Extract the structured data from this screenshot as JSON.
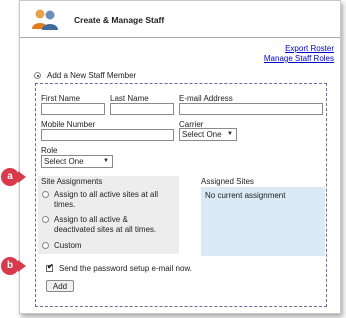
{
  "header": {
    "title": "Create & Manage Staff",
    "logo_icon": "staff-users-icon"
  },
  "links": {
    "export_roster": "Export Roster",
    "manage_roles": "Manage Staff Roles"
  },
  "add_new": {
    "label": "Add a New Staff Member",
    "checked": true
  },
  "fields": {
    "first_name": {
      "label": "First Name",
      "value": ""
    },
    "last_name": {
      "label": "Last Name",
      "value": ""
    },
    "email": {
      "label": "E-mail Address",
      "value": ""
    },
    "mobile": {
      "label": "Mobile Number",
      "value": ""
    },
    "carrier": {
      "label": "Carrier",
      "value": "Select One"
    },
    "role": {
      "label": "Role",
      "value": "Select One"
    }
  },
  "site_assignments": {
    "title": "Site Assignments",
    "options": [
      {
        "lines": [
          "Assign to all active sites at all",
          "times."
        ],
        "checked": false
      },
      {
        "lines": [
          "Assign to all active &",
          "deactivated sites at all times."
        ],
        "checked": false
      },
      {
        "lines": [
          "Custom"
        ],
        "checked": false
      }
    ]
  },
  "assigned_sites": {
    "title": "Assigned Sites",
    "empty_text": "No current assignment"
  },
  "send_email": {
    "label": "Send the password setup e-mail now.",
    "checked": true
  },
  "add_button": {
    "label": "Add"
  },
  "callouts": {
    "a": "a",
    "b": "b"
  },
  "colors": {
    "callout": "#d83a4b",
    "link": "#0000cc",
    "assigned_bg": "#daeaf7",
    "section_bg": "#ededed"
  }
}
